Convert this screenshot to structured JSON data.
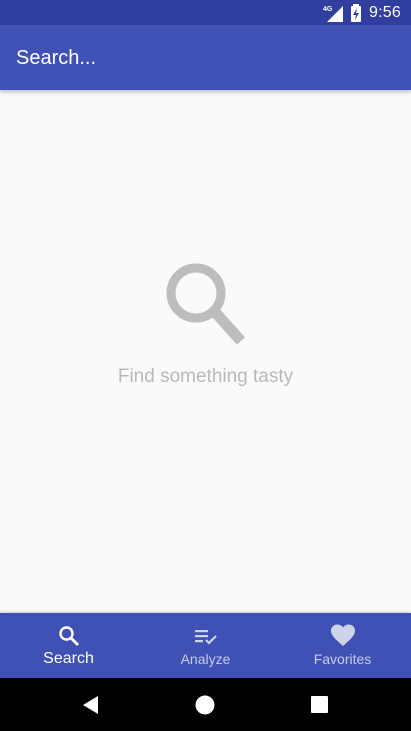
{
  "status_bar": {
    "network_type": "4G",
    "time": "9:56",
    "icons": [
      "signal-icon",
      "battery-charging-icon"
    ]
  },
  "search": {
    "placeholder": "Search..."
  },
  "empty_state": {
    "icon": "search-icon",
    "message": "Find something tasty"
  },
  "bottom_nav": {
    "items": [
      {
        "label": "Search",
        "icon": "search-icon",
        "active": true
      },
      {
        "label": "Analyze",
        "icon": "checklist-icon",
        "active": false
      },
      {
        "label": "Favorites",
        "icon": "heart-icon",
        "active": false
      }
    ]
  },
  "system_nav": {
    "buttons": [
      "back-icon",
      "home-icon",
      "recents-icon"
    ]
  },
  "colors": {
    "primary": "#3f51b5",
    "primary_dark": "#303f9f",
    "background": "#fafafa",
    "empty_text": "#b9b9b9"
  }
}
